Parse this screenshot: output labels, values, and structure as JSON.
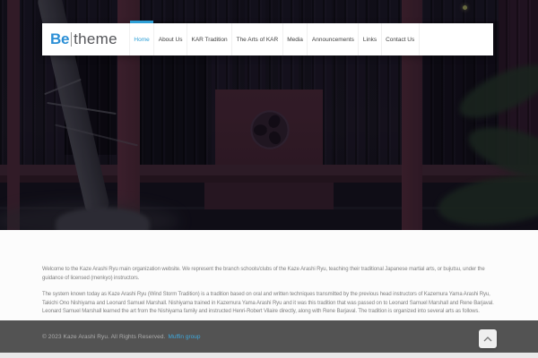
{
  "brand": {
    "logo_bold": "Be",
    "logo_divider": "|",
    "logo_light": "theme"
  },
  "nav": {
    "items": [
      {
        "label": "Home",
        "active": true
      },
      {
        "label": "About Us",
        "active": false
      },
      {
        "label": "KAR Tradition",
        "active": false
      },
      {
        "label": "The Arts of KAR",
        "active": false
      },
      {
        "label": "Media",
        "active": false
      },
      {
        "label": "Announcements",
        "active": false
      },
      {
        "label": "Links",
        "active": false
      },
      {
        "label": "Contact Us",
        "active": false
      }
    ]
  },
  "hero": {
    "image_subject": "dark japanese shrine with red columns, tree and mitsudomoe crest"
  },
  "content": {
    "paragraphs": [
      "Welcome to the Kaze Arashi Ryu main organization website. We represent the branch schools/clubs of the Kaze Arashi Ryu, teaching their traditional Japanese martial arts, or bujutsu, under the guidance of licensed (menkyo) instructors.",
      "The system known today as Kaze Arashi Ryu (Wind Storm Tradition) is a tradition based on oral and written techniques transmitted by the previous head instructors of Kazemura Yama Arashi Ryu, Takichi Ono Nishiyama and Leonard Samuel Marshall. Nishiyama trained in Kazemura Yama Arashi Ryu and it was this tradition that was passed on to Leonard Samuel Marshall and Rene Barjaval. Leonard Samuel Marshall learned the art from the Nishiyama family and instructed Henri-Robert Vilaire directly, along with Rene Barjaval. The tradition is organized into several arts as follows."
    ]
  },
  "footer": {
    "copyright": "© 2023 Kaze Arashi Ryu. All Rights Reserved.",
    "credit": "Muffin group"
  },
  "colors": {
    "accent": "#2e9fd6",
    "credit_link": "#3fa9dd",
    "footer_bg": "#535353",
    "hero_base": "#15121e",
    "shrine_red": "#3a1f2c"
  }
}
